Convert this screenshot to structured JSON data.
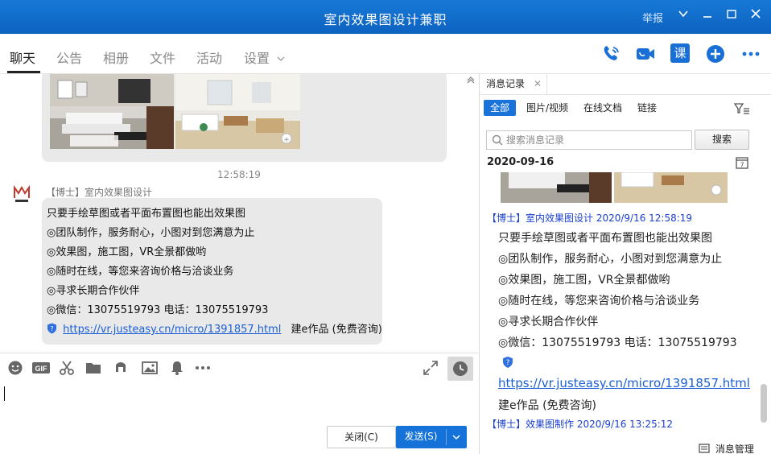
{
  "window": {
    "title": "室内效果图设计兼职",
    "report_label": "举报"
  },
  "tabs": [
    {
      "label": "聊天"
    },
    {
      "label": "公告"
    },
    {
      "label": "相册"
    },
    {
      "label": "文件"
    },
    {
      "label": "活动"
    },
    {
      "label": "设置"
    }
  ],
  "top_actions": {
    "course_label": "课"
  },
  "chat": {
    "timestamp": "12:58:19",
    "sender": "【博士】室内效果图设计",
    "lines": [
      "只要手绘草图或者平面布置图也能出效果图",
      "◎团队制作，服务耐心，小图对到您满意为止",
      "◎效果图，施工图，VR全景都做哟",
      "◎随时在线，等您来咨询价格与洽谈业务",
      "◎寻求长期合作伙伴",
      "◎微信：13075519793   电话：13075519793"
    ],
    "link": "https://vr.justeasy.cn/micro/1391857.html",
    "link_suffix": "建e作品 (免费咨询)"
  },
  "composer": {
    "close_label": "关闭(C)",
    "send_label": "发送(S)"
  },
  "history": {
    "tab_label": "消息记录",
    "filters": [
      "全部",
      "图片/视频",
      "在线文档",
      "链接"
    ],
    "search_placeholder": "搜索消息记录",
    "search_button": "搜索",
    "date": "2020-09-16",
    "entry1_sender": "【博士】室内效果图设计 2020/9/16 12:58:19",
    "entry1_lines": [
      "只要手绘草图或者平面布置图也能出效果图",
      "◎团队制作，服务耐心，小图对到您满意为止",
      "◎效果图，施工图，VR全景都做哟",
      "◎随时在线，等您来咨询价格与洽谈业务",
      "◎寻求长期合作伙伴",
      "◎微信：13075519793   电话：13075519793"
    ],
    "entry1_link": "https://vr.justeasy.cn/micro/1391857.html",
    "entry1_suffix": "建e作品 (免费咨询)",
    "entry2_sender": "【博士】效果图制作 2020/9/16 13:25:12",
    "manage_label": "消息管理"
  },
  "colors": {
    "titlebar": "#0d62c0",
    "accent": "#1472d9",
    "link": "#1a5fd6",
    "bubble": "#e9e9e9"
  }
}
